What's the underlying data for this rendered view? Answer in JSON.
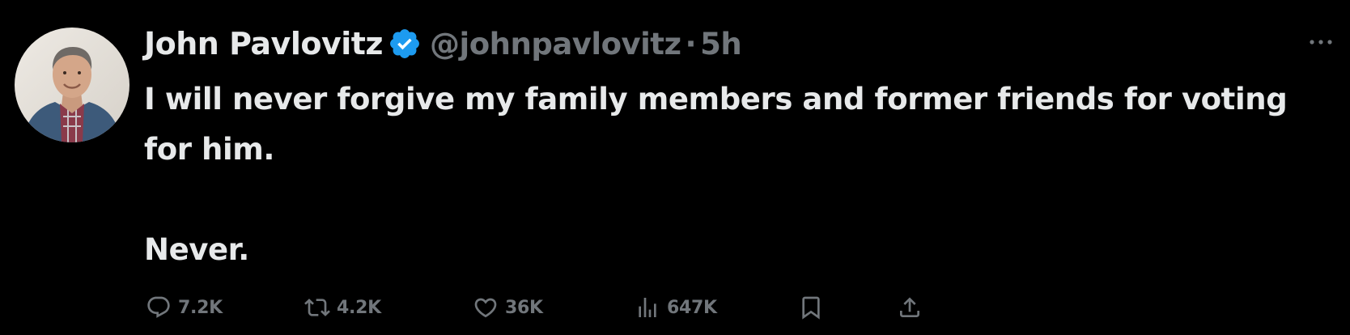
{
  "tweet": {
    "author": {
      "display_name": "John Pavlovitz",
      "handle": "@johnpavlovitz",
      "verified": true
    },
    "separator": "·",
    "time": "5h",
    "text_lines": [
      "I will never forgive my family members and former friends for voting for him.",
      "",
      "Never."
    ],
    "metrics": {
      "replies": "7.2K",
      "reposts": "4.2K",
      "likes": "36K",
      "views": "647K"
    },
    "icons": {
      "reply": "reply-icon",
      "repost": "repost-icon",
      "like": "heart-icon",
      "views": "views-icon",
      "bookmark": "bookmark-icon",
      "share": "share-icon",
      "more": "more-icon",
      "verified": "verified-badge-icon"
    }
  },
  "colors": {
    "background": "#000000",
    "primary_text": "#e7e9ea",
    "secondary_text": "#71767b",
    "verified_blue": "#1d9bf0"
  }
}
